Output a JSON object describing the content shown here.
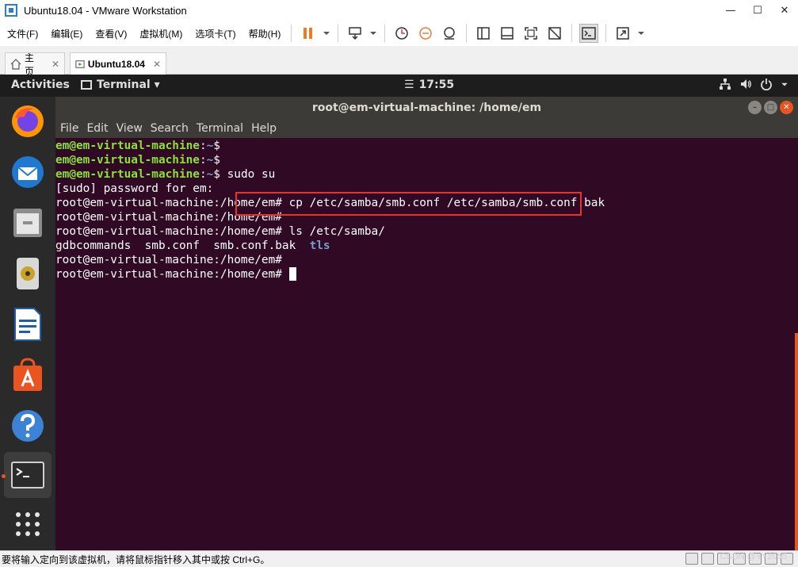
{
  "window": {
    "title": "Ubuntu18.04 - VMware Workstation"
  },
  "menu": {
    "items": [
      "文件(F)",
      "编辑(E)",
      "查看(V)",
      "虚拟机(M)",
      "选项卡(T)",
      "帮助(H)"
    ]
  },
  "tabs": [
    {
      "label": "主页",
      "icon": "home-icon"
    },
    {
      "label": "Ubuntu18.04",
      "icon": "vm-icon"
    }
  ],
  "ubuntu": {
    "activities": "Activities",
    "app_menu": "Terminal ▾",
    "clock": "17:55"
  },
  "terminal": {
    "title": "root@em-virtual-machine: /home/em",
    "menu": [
      "File",
      "Edit",
      "View",
      "Search",
      "Terminal",
      "Help"
    ],
    "user_prompt": "em@em-virtual-machine",
    "home_path": "~",
    "root_prompt": "root@em-virtual-machine:/home/em#",
    "lines": {
      "l1_cmd": "",
      "l2_cmd": "",
      "l3_cmd": " sudo su",
      "l4": "[sudo] password for em:",
      "l5_cmd": " cp /etc/samba/smb.conf /etc/samba/smb.conf.bak",
      "l6_cmd": "",
      "l7_cmd": " ls /etc/samba/",
      "l8_files": "gdbcommands  smb.conf  smb.conf.bak  ",
      "l8_dir": "tls",
      "l9_cmd": "",
      "l10_cmd": " "
    }
  },
  "statusbar": {
    "message": "要将输入定向到该虚拟机，请将鼠标指针移入其中或按 Ctrl+G。",
    "watermark": "CSDN @YY2055"
  },
  "colors": {
    "terminal_bg": "#300a24",
    "prompt_green": "#8ae234",
    "path_blue": "#729fcf",
    "highlight_red": "#e3342f",
    "ubuntu_orange": "#e95420"
  }
}
